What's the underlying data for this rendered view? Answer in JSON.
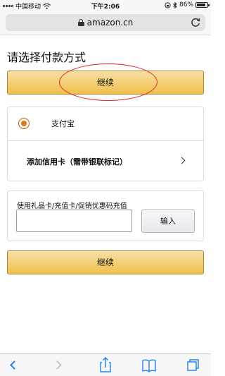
{
  "status_bar": {
    "carrier": "中国移动",
    "time": "下午2:06",
    "battery_percent": "86%",
    "battery_level": 0.86
  },
  "browser": {
    "url": "amazon.cn"
  },
  "page": {
    "title": "请选择付款方式",
    "continue_top_label": "继续",
    "payment_methods": {
      "alipay_label": "支付宝",
      "alipay_selected": true,
      "add_card_label": "添加信用卡（需带银联标记）"
    },
    "gift_card": {
      "label": "使用礼品卡/充值卡/促销优惠码充值",
      "input_value": "",
      "apply_label": "输入"
    },
    "continue_bottom_label": "继续"
  },
  "colors": {
    "button_gold": "#f0c14b",
    "radio_orange": "#e47911",
    "annotation_red": "#e0262a",
    "link_blue": "#1a82fb"
  },
  "toolbar": {
    "icons": [
      "back-icon",
      "forward-icon",
      "share-icon",
      "bookmarks-icon",
      "tabs-icon"
    ]
  }
}
